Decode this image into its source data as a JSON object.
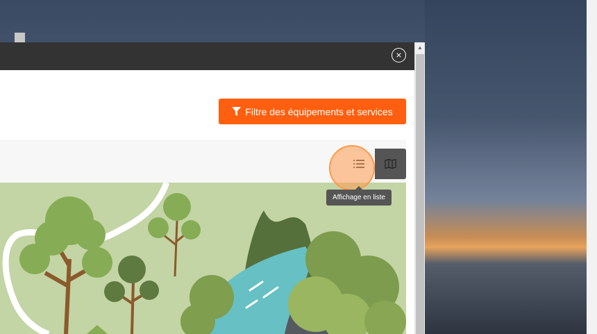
{
  "modal": {
    "close_symbol": "×",
    "filter_button_label": "Filtre des équipements et services",
    "tooltip_text": "Affichage en liste"
  },
  "icons": {
    "filter": "funnel-icon",
    "list": "list-view-icon",
    "map": "map-view-icon",
    "close": "close-icon",
    "scroll_up": "arrow-up-icon"
  },
  "colors": {
    "header": "#333333",
    "accent": "#ff5f0f",
    "map_button": "#555555",
    "tooltip": "#555555",
    "illustration_bg": "#c3d4a5"
  }
}
